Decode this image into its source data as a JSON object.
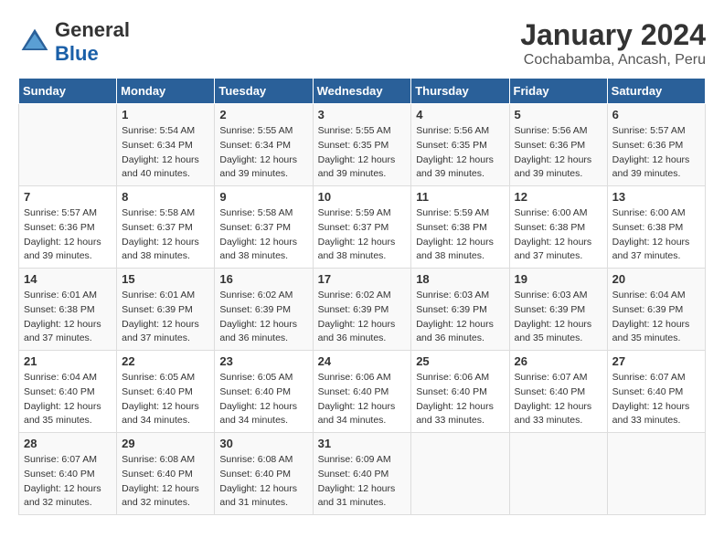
{
  "header": {
    "logo_general": "General",
    "logo_blue": "Blue",
    "month": "January 2024",
    "location": "Cochabamba, Ancash, Peru"
  },
  "weekdays": [
    "Sunday",
    "Monday",
    "Tuesday",
    "Wednesday",
    "Thursday",
    "Friday",
    "Saturday"
  ],
  "weeks": [
    [
      {
        "day": "",
        "sunrise": "",
        "sunset": "",
        "daylight": ""
      },
      {
        "day": "1",
        "sunrise": "Sunrise: 5:54 AM",
        "sunset": "Sunset: 6:34 PM",
        "daylight": "Daylight: 12 hours and 40 minutes."
      },
      {
        "day": "2",
        "sunrise": "Sunrise: 5:55 AM",
        "sunset": "Sunset: 6:34 PM",
        "daylight": "Daylight: 12 hours and 39 minutes."
      },
      {
        "day": "3",
        "sunrise": "Sunrise: 5:55 AM",
        "sunset": "Sunset: 6:35 PM",
        "daylight": "Daylight: 12 hours and 39 minutes."
      },
      {
        "day": "4",
        "sunrise": "Sunrise: 5:56 AM",
        "sunset": "Sunset: 6:35 PM",
        "daylight": "Daylight: 12 hours and 39 minutes."
      },
      {
        "day": "5",
        "sunrise": "Sunrise: 5:56 AM",
        "sunset": "Sunset: 6:36 PM",
        "daylight": "Daylight: 12 hours and 39 minutes."
      },
      {
        "day": "6",
        "sunrise": "Sunrise: 5:57 AM",
        "sunset": "Sunset: 6:36 PM",
        "daylight": "Daylight: 12 hours and 39 minutes."
      }
    ],
    [
      {
        "day": "7",
        "sunrise": "Sunrise: 5:57 AM",
        "sunset": "Sunset: 6:36 PM",
        "daylight": "Daylight: 12 hours and 39 minutes."
      },
      {
        "day": "8",
        "sunrise": "Sunrise: 5:58 AM",
        "sunset": "Sunset: 6:37 PM",
        "daylight": "Daylight: 12 hours and 38 minutes."
      },
      {
        "day": "9",
        "sunrise": "Sunrise: 5:58 AM",
        "sunset": "Sunset: 6:37 PM",
        "daylight": "Daylight: 12 hours and 38 minutes."
      },
      {
        "day": "10",
        "sunrise": "Sunrise: 5:59 AM",
        "sunset": "Sunset: 6:37 PM",
        "daylight": "Daylight: 12 hours and 38 minutes."
      },
      {
        "day": "11",
        "sunrise": "Sunrise: 5:59 AM",
        "sunset": "Sunset: 6:38 PM",
        "daylight": "Daylight: 12 hours and 38 minutes."
      },
      {
        "day": "12",
        "sunrise": "Sunrise: 6:00 AM",
        "sunset": "Sunset: 6:38 PM",
        "daylight": "Daylight: 12 hours and 37 minutes."
      },
      {
        "day": "13",
        "sunrise": "Sunrise: 6:00 AM",
        "sunset": "Sunset: 6:38 PM",
        "daylight": "Daylight: 12 hours and 37 minutes."
      }
    ],
    [
      {
        "day": "14",
        "sunrise": "Sunrise: 6:01 AM",
        "sunset": "Sunset: 6:38 PM",
        "daylight": "Daylight: 12 hours and 37 minutes."
      },
      {
        "day": "15",
        "sunrise": "Sunrise: 6:01 AM",
        "sunset": "Sunset: 6:39 PM",
        "daylight": "Daylight: 12 hours and 37 minutes."
      },
      {
        "day": "16",
        "sunrise": "Sunrise: 6:02 AM",
        "sunset": "Sunset: 6:39 PM",
        "daylight": "Daylight: 12 hours and 36 minutes."
      },
      {
        "day": "17",
        "sunrise": "Sunrise: 6:02 AM",
        "sunset": "Sunset: 6:39 PM",
        "daylight": "Daylight: 12 hours and 36 minutes."
      },
      {
        "day": "18",
        "sunrise": "Sunrise: 6:03 AM",
        "sunset": "Sunset: 6:39 PM",
        "daylight": "Daylight: 12 hours and 36 minutes."
      },
      {
        "day": "19",
        "sunrise": "Sunrise: 6:03 AM",
        "sunset": "Sunset: 6:39 PM",
        "daylight": "Daylight: 12 hours and 35 minutes."
      },
      {
        "day": "20",
        "sunrise": "Sunrise: 6:04 AM",
        "sunset": "Sunset: 6:39 PM",
        "daylight": "Daylight: 12 hours and 35 minutes."
      }
    ],
    [
      {
        "day": "21",
        "sunrise": "Sunrise: 6:04 AM",
        "sunset": "Sunset: 6:40 PM",
        "daylight": "Daylight: 12 hours and 35 minutes."
      },
      {
        "day": "22",
        "sunrise": "Sunrise: 6:05 AM",
        "sunset": "Sunset: 6:40 PM",
        "daylight": "Daylight: 12 hours and 34 minutes."
      },
      {
        "day": "23",
        "sunrise": "Sunrise: 6:05 AM",
        "sunset": "Sunset: 6:40 PM",
        "daylight": "Daylight: 12 hours and 34 minutes."
      },
      {
        "day": "24",
        "sunrise": "Sunrise: 6:06 AM",
        "sunset": "Sunset: 6:40 PM",
        "daylight": "Daylight: 12 hours and 34 minutes."
      },
      {
        "day": "25",
        "sunrise": "Sunrise: 6:06 AM",
        "sunset": "Sunset: 6:40 PM",
        "daylight": "Daylight: 12 hours and 33 minutes."
      },
      {
        "day": "26",
        "sunrise": "Sunrise: 6:07 AM",
        "sunset": "Sunset: 6:40 PM",
        "daylight": "Daylight: 12 hours and 33 minutes."
      },
      {
        "day": "27",
        "sunrise": "Sunrise: 6:07 AM",
        "sunset": "Sunset: 6:40 PM",
        "daylight": "Daylight: 12 hours and 33 minutes."
      }
    ],
    [
      {
        "day": "28",
        "sunrise": "Sunrise: 6:07 AM",
        "sunset": "Sunset: 6:40 PM",
        "daylight": "Daylight: 12 hours and 32 minutes."
      },
      {
        "day": "29",
        "sunrise": "Sunrise: 6:08 AM",
        "sunset": "Sunset: 6:40 PM",
        "daylight": "Daylight: 12 hours and 32 minutes."
      },
      {
        "day": "30",
        "sunrise": "Sunrise: 6:08 AM",
        "sunset": "Sunset: 6:40 PM",
        "daylight": "Daylight: 12 hours and 31 minutes."
      },
      {
        "day": "31",
        "sunrise": "Sunrise: 6:09 AM",
        "sunset": "Sunset: 6:40 PM",
        "daylight": "Daylight: 12 hours and 31 minutes."
      },
      {
        "day": "",
        "sunrise": "",
        "sunset": "",
        "daylight": ""
      },
      {
        "day": "",
        "sunrise": "",
        "sunset": "",
        "daylight": ""
      },
      {
        "day": "",
        "sunrise": "",
        "sunset": "",
        "daylight": ""
      }
    ]
  ]
}
